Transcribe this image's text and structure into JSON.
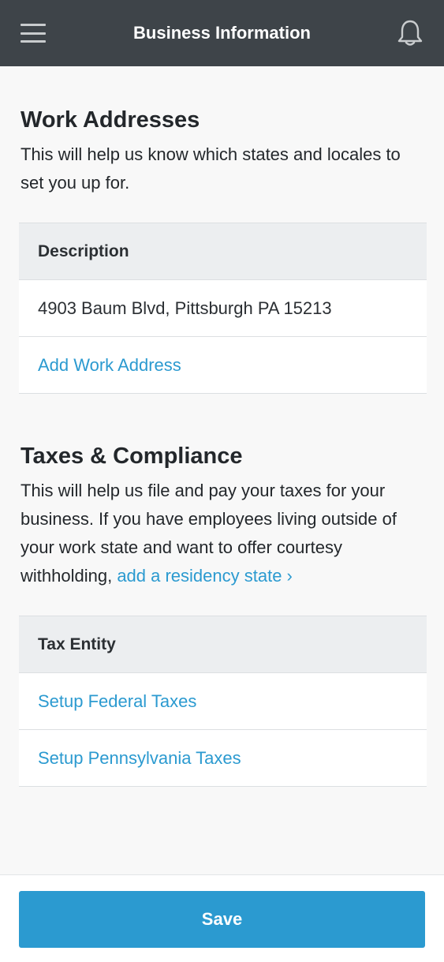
{
  "header": {
    "title": "Business Information",
    "menu_icon": "hamburger-menu-icon",
    "bell_icon": "bell-icon"
  },
  "work_addresses": {
    "heading": "Work Addresses",
    "description": "This will help us know which states and locales to set you up for.",
    "table_header": "Description",
    "rows": [
      "4903 Baum Blvd, Pittsburgh PA 15213"
    ],
    "add_link": "Add Work Address"
  },
  "taxes": {
    "heading": "Taxes & Compliance",
    "description": "This will help us file and pay your taxes for your business. If you have employees living outside of your work state and want to offer courtesy withholding,",
    "residency_link": "add a residency state ›",
    "table_header": "Tax Entity",
    "links": [
      "Setup Federal Taxes",
      "Setup Pennsylvania Taxes"
    ]
  },
  "footer": {
    "save_label": "Save"
  },
  "colors": {
    "topbar": "#3e4449",
    "accent": "#2b9ad0",
    "background": "#f8f8f8"
  }
}
